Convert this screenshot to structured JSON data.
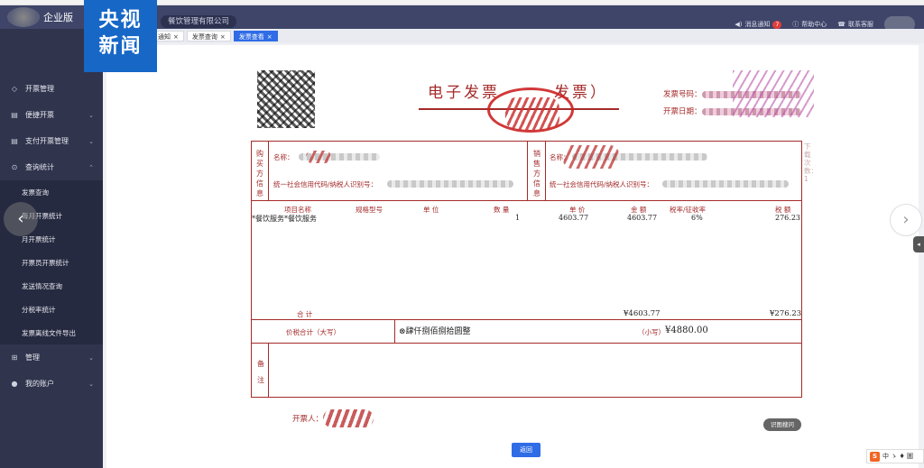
{
  "header": {
    "logo_text": "企业版",
    "company_name": "餐饮管理有限公司",
    "notifications_label": "消息通知",
    "notifications_count": "7",
    "help_label": "帮助中心",
    "support_label": "联系客服"
  },
  "watermark": {
    "line1": "央视",
    "line2": "新闻"
  },
  "tabs": [
    {
      "label": "通知"
    },
    {
      "label": "发票查询"
    },
    {
      "label": "发票查看"
    }
  ],
  "sidebar": {
    "items": [
      {
        "label": "开票管理",
        "icon": "document-icon"
      },
      {
        "label": "便捷开票",
        "icon": "quick-invoice-icon"
      },
      {
        "label": "支付开票管理",
        "icon": "payment-icon"
      },
      {
        "label": "查询统计",
        "icon": "search-icon"
      }
    ],
    "sub_items": [
      "发票查询",
      "每月开票统计",
      "月开票统计",
      "开票员开票统计",
      "发送情况查询",
      "分税率统计",
      "发票离线文件导出"
    ],
    "bottom_items": [
      {
        "label": "管理",
        "icon": "grid-icon"
      },
      {
        "label": "我的账户",
        "icon": "user-icon"
      }
    ]
  },
  "invoice": {
    "title_left": "电子发票",
    "title_right": "发票）",
    "number_label": "发票号码：",
    "date_label": "开票日期：",
    "buyer_section": "购买方信息",
    "seller_section": "销售方信息",
    "name_label": "名称：",
    "seller_name_label": "名称：",
    "tax_id_label": "统一社会信用代码/纳税人识别号：",
    "columns": {
      "item": "项目名称",
      "spec": "规格型号",
      "unit": "单 位",
      "qty": "数 量",
      "price": "单 价",
      "amount": "金 额",
      "rate": "税率/征收率",
      "tax": "税 额"
    },
    "line_item": {
      "item": "*餐饮服务*餐饮服务",
      "qty": "1",
      "price": "4603.77",
      "amount": "4603.77",
      "rate": "6%",
      "tax": "276.23"
    },
    "total_label": "合 计",
    "total_amount": "¥4603.77",
    "total_tax": "¥276.23",
    "grand_label": "价税合计（大写）",
    "grand_upper": "肆仟捌佰捌拾圆整",
    "grand_small_label": "（小写）",
    "grand_small": "¥4880.00",
    "remark_label": "备注",
    "issuer_label": "开票人：",
    "side_note": "下载次数：1"
  },
  "actions": {
    "back_label": "返回",
    "rotate_label": "识图搜问"
  },
  "ime": {
    "logo": "S",
    "items": "中 ゝ ♦ 圖"
  }
}
